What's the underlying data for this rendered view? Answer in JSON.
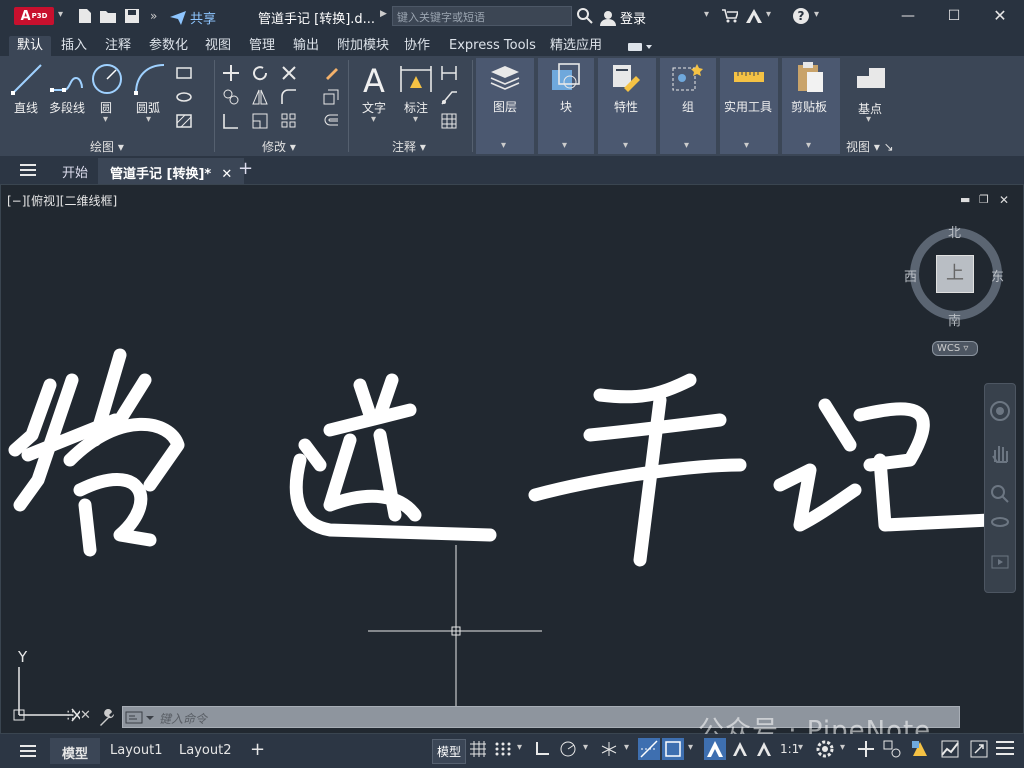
{
  "titlebar": {
    "app_logo": "A",
    "app_logo_sub": "P3D",
    "share_label": "共享",
    "doc_title": "管道手记 [转换].d...",
    "search_placeholder": "键入关键字或短语",
    "login_label": "登录"
  },
  "ribbon_tabs": [
    "默认",
    "插入",
    "注释",
    "参数化",
    "视图",
    "管理",
    "输出",
    "附加模块",
    "协作",
    "Express Tools",
    "精选应用"
  ],
  "ribbon": {
    "draw": {
      "title": "绘图",
      "line": "直线",
      "polyline": "多段线",
      "circle": "圆",
      "arc": "圆弧"
    },
    "modify": {
      "title": "修改"
    },
    "annotation": {
      "title": "注释",
      "text": "文字",
      "dimension": "标注"
    },
    "layers": "图层",
    "block": "块",
    "properties": "特性",
    "groups": "组",
    "utilities": "实用工具",
    "clipboard": "剪贴板",
    "view": {
      "title": "视图",
      "basepoint": "基点"
    }
  },
  "doc_tabs": {
    "start": "开始",
    "active": "管道手记 [转换]*"
  },
  "viewport": {
    "label": "[−][俯视][二维线框]",
    "viewcube": {
      "face": "上",
      "north": "北",
      "south": "南",
      "east": "东",
      "west": "西",
      "wcs": "WCS"
    },
    "ucs_y": "Y"
  },
  "command_line": {
    "placeholder": "键入命令"
  },
  "watermark": "公众号 · PipeNote",
  "statusbar": {
    "tabs": [
      "模型",
      "Layout1",
      "Layout2"
    ],
    "model_toggle": "模型",
    "scale": "1:1"
  }
}
